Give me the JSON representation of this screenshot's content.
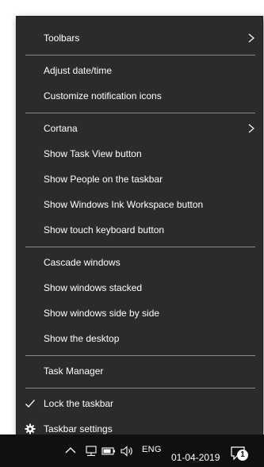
{
  "context_menu": {
    "items": [
      {
        "label": "Toolbars",
        "submenu": true
      },
      {
        "label": "Adjust date/time"
      },
      {
        "label": "Customize notification icons"
      },
      {
        "label": "Cortana",
        "submenu": true
      },
      {
        "label": "Show Task View button"
      },
      {
        "label": "Show People on the taskbar"
      },
      {
        "label": "Show Windows Ink Workspace button"
      },
      {
        "label": "Show touch keyboard button"
      },
      {
        "label": "Cascade windows"
      },
      {
        "label": "Show windows stacked"
      },
      {
        "label": "Show windows side by side"
      },
      {
        "label": "Show the desktop"
      },
      {
        "label": "Task Manager"
      },
      {
        "label": "Lock the taskbar",
        "checked": true,
        "icon": "checkmark-icon"
      },
      {
        "label": "Taskbar settings",
        "icon": "gear-icon"
      }
    ]
  },
  "taskbar": {
    "language": "ENG",
    "date": "01-04-2019",
    "notification_count": "1",
    "tray_icons": [
      "show-hidden-icons-chevron",
      "network-icon",
      "battery-icon",
      "volume-icon"
    ]
  },
  "colors": {
    "menu_background": "#2b2b2b",
    "menu_text": "#ffffff",
    "separator": "#8a8a8a",
    "taskbar_background": "#101010",
    "page_background": "#ffffff"
  }
}
